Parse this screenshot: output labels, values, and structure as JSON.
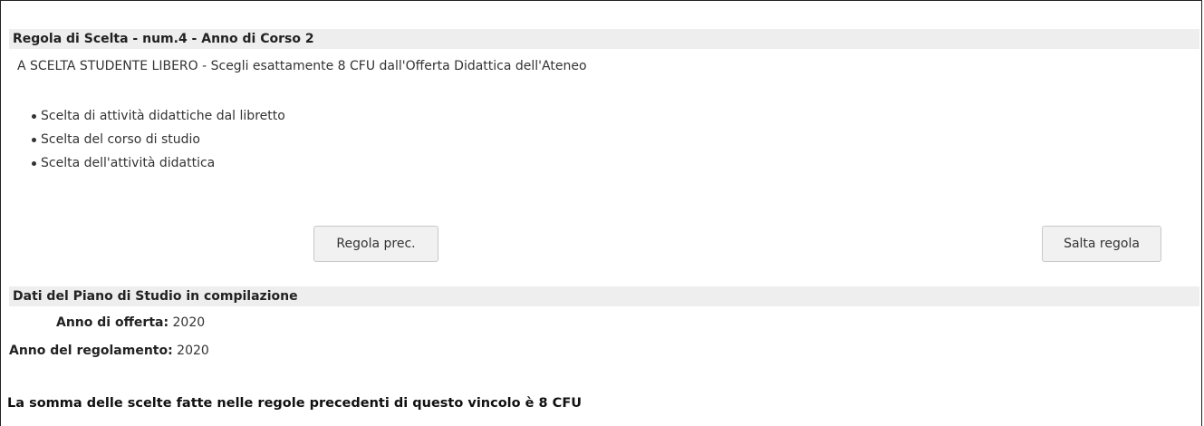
{
  "rule": {
    "header": "Regola di Scelta - num.4 - Anno di Corso 2",
    "description": "A SCELTA STUDENTE LIBERO - Scegli esattamente 8 CFU dall'Offerta Didattica dell'Ateneo",
    "options": [
      "Scelta di attività didattiche dal libretto",
      "Scelta del corso di studio",
      "Scelta dell'attività didattica"
    ]
  },
  "buttons": {
    "prev_label": "Regola prec.",
    "skip_label": "Salta regola"
  },
  "plan": {
    "header": "Dati del Piano di Studio in compilazione",
    "anno_offerta_label": "Anno di offerta:",
    "anno_offerta_value": "2020",
    "anno_regolamento_label": "Anno del regolamento:",
    "anno_regolamento_value": "2020"
  },
  "summary": "La somma delle scelte fatte nelle regole precedenti di questo vincolo è 8 CFU"
}
